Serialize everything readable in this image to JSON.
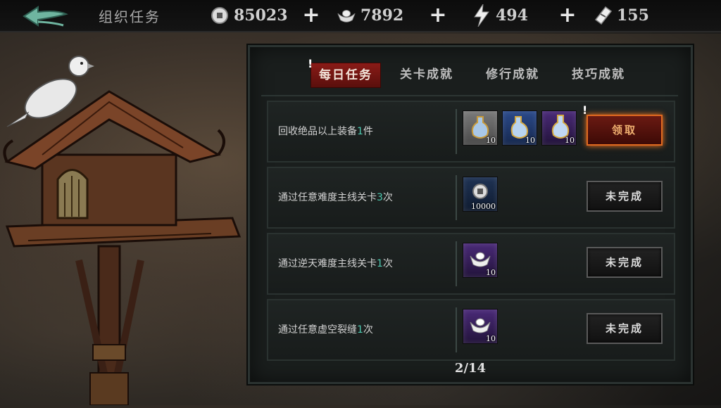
{
  "header": {
    "title": "组织任务",
    "resources": [
      {
        "icon": "coin-icon",
        "value": "85023"
      },
      {
        "icon": "silver-ingot-icon",
        "value": "7892"
      },
      {
        "icon": "lightning-icon",
        "value": "494"
      },
      {
        "icon": "ticket-icon",
        "value": "155"
      }
    ]
  },
  "tabs": [
    {
      "label": "每日任务",
      "active": true
    },
    {
      "label": "关卡成就",
      "active": false
    },
    {
      "label": "修行成就",
      "active": false
    },
    {
      "label": "技巧成就",
      "active": false
    }
  ],
  "tasks": [
    {
      "prefix": "回收绝品以上装备",
      "count": "1",
      "suffix": "件",
      "rewards": [
        {
          "icon": "potion-grey-icon",
          "count": "10",
          "rarity": "grey"
        },
        {
          "icon": "potion-blue-icon",
          "count": "10",
          "rarity": "blue"
        },
        {
          "icon": "potion-purple-icon",
          "count": "10",
          "rarity": "purple"
        }
      ],
      "button": "领取",
      "status": "claimable"
    },
    {
      "prefix": "通过任意难度主线关卡",
      "count": "3",
      "suffix": "次",
      "rewards": [
        {
          "icon": "coin-icon",
          "count": "10000",
          "rarity": "navy"
        }
      ],
      "button": "未完成",
      "status": "incomplete"
    },
    {
      "prefix": "通过逆天难度主线关卡",
      "count": "1",
      "suffix": "次",
      "rewards": [
        {
          "icon": "silver-ingot-icon",
          "count": "10",
          "rarity": "purple"
        }
      ],
      "button": "未完成",
      "status": "incomplete"
    },
    {
      "prefix": "通过任意虚空裂缝",
      "count": "1",
      "suffix": "次",
      "rewards": [
        {
          "icon": "silver-ingot-icon",
          "count": "10",
          "rarity": "purple"
        }
      ],
      "button": "未完成",
      "status": "incomplete"
    }
  ],
  "pager": "2/14",
  "colors": {
    "accent_count": "#4ec9b0",
    "claim_glow": "#e06a20",
    "active_tab": "#8a1b17"
  }
}
